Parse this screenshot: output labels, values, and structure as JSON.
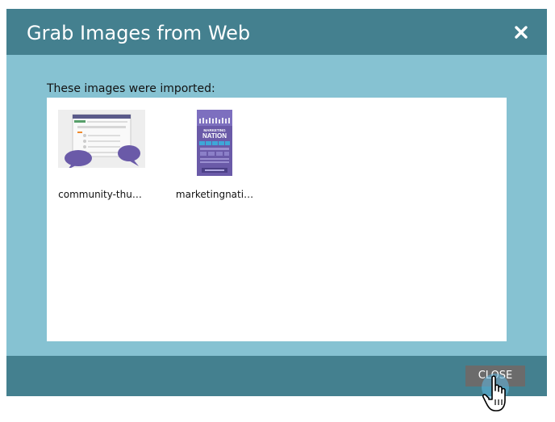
{
  "dialog": {
    "title": "Grab Images from Web",
    "intro": "These images were imported:",
    "close_button_label": "CLOSE"
  },
  "images": [
    {
      "label": "community-thu…",
      "icon": "community-thumbnail-image"
    },
    {
      "label": "marketingnati…",
      "icon": "marketing-nation-thumbnail-image"
    }
  ],
  "thumbnail_text": {
    "marketing": "MARKETING",
    "nation": "NATION"
  },
  "colors": {
    "header_bg": "#44808f",
    "body_bg": "#86c2d2",
    "button_bg": "#6b6b6b",
    "accent_purple": "#6a5aa8"
  }
}
